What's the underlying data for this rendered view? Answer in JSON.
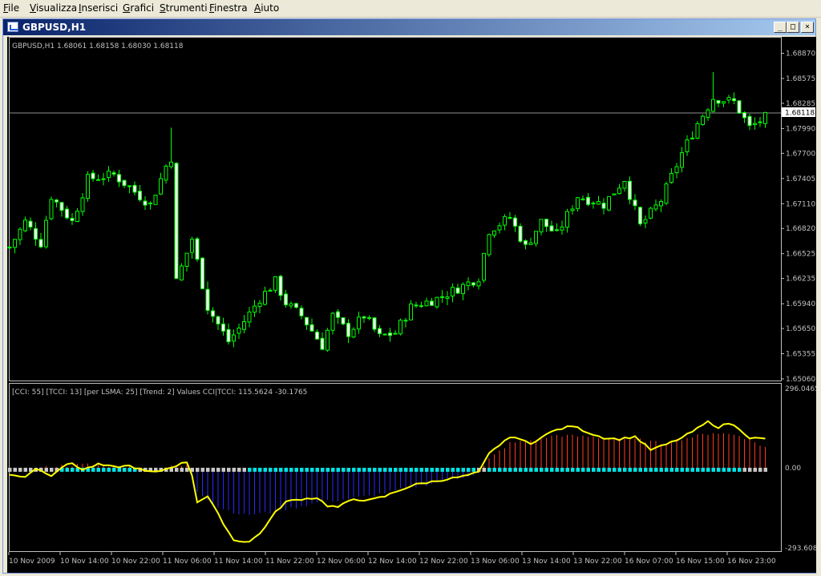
{
  "menu": [
    "File",
    "Visualizza",
    "Inserisci",
    "Grafici",
    "Strumenti",
    "Finestra",
    "Aiuto"
  ],
  "window": {
    "title": "GBPUSD,H1",
    "icon": "chart-window-icon",
    "buttons": {
      "minimize": "_",
      "maximize": "□",
      "close": "×"
    }
  },
  "colors": {
    "background": "#000000",
    "bull_candle": "#00ff00",
    "bear_candle_fill": "#ffffff",
    "cci_line": "#ffff00",
    "histogram_up": "#ff3b1f",
    "histogram_down": "#2a2aff",
    "trend_up_dot": "#00e5e5",
    "trend_neutral_dot": "#c8c8c8",
    "axis_text": "#c0c0c0"
  },
  "price_header": "GBPUSD,H1  1.68061 1.68158 1.68030 1.68118",
  "current_price": "1.68118",
  "price_axis": [
    "1.68870",
    "1.68575",
    "1.68285",
    "1.67990",
    "1.67700",
    "1.67405",
    "1.67110",
    "1.66820",
    "1.66525",
    "1.66235",
    "1.65940",
    "1.65650",
    "1.65355",
    "1.65060"
  ],
  "indicator_header": "[CCI: 55] [TCCI: 13] [per LSMA: 25] [Trend: 2] Values CCI|TCCI: 115.5624 -30.1765",
  "indicator_axis": {
    "top": "296.0465",
    "zero": "0.00",
    "bottom": "-293.608"
  },
  "time_axis": [
    "10 Nov 2009",
    "10 Nov 14:00",
    "10 Nov 22:00",
    "11 Nov 06:00",
    "11 Nov 14:00",
    "11 Nov 22:00",
    "12 Nov 06:00",
    "12 Nov 14:00",
    "12 Nov 22:00",
    "13 Nov 06:00",
    "13 Nov 14:00",
    "13 Nov 22:00",
    "16 Nov 07:00",
    "16 Nov 15:00",
    "16 Nov 23:00"
  ],
  "chart_data": [
    {
      "type": "candlestick",
      "title": "GBPUSD,H1",
      "ylim": [
        1.6506,
        1.6895
      ],
      "anchor_closes": [
        [
          0,
          1.666
        ],
        [
          3,
          1.669
        ],
        [
          6,
          1.6665
        ],
        [
          8,
          1.672
        ],
        [
          12,
          1.669
        ],
        [
          15,
          1.674
        ],
        [
          20,
          1.6745
        ],
        [
          27,
          1.671
        ],
        [
          30,
          1.6755
        ],
        [
          31,
          1.6765
        ],
        [
          32,
          1.662
        ],
        [
          35,
          1.667
        ],
        [
          38,
          1.659
        ],
        [
          42,
          1.655
        ],
        [
          44,
          1.6565
        ],
        [
          48,
          1.66
        ],
        [
          51,
          1.662
        ],
        [
          53,
          1.6595
        ],
        [
          56,
          1.658
        ],
        [
          60,
          1.6545
        ],
        [
          62,
          1.658
        ],
        [
          65,
          1.656
        ],
        [
          68,
          1.658
        ],
        [
          71,
          1.6555
        ],
        [
          74,
          1.656
        ],
        [
          77,
          1.659
        ],
        [
          82,
          1.66
        ],
        [
          87,
          1.6615
        ],
        [
          90,
          1.6625
        ],
        [
          92,
          1.668
        ],
        [
          96,
          1.6695
        ],
        [
          99,
          1.666
        ],
        [
          102,
          1.669
        ],
        [
          105,
          1.6675
        ],
        [
          109,
          1.672
        ],
        [
          114,
          1.671
        ],
        [
          118,
          1.674
        ],
        [
          121,
          1.6685
        ],
        [
          125,
          1.6715
        ],
        [
          129,
          1.677
        ],
        [
          132,
          1.6805
        ],
        [
          135,
          1.6835
        ],
        [
          139,
          1.683
        ],
        [
          142,
          1.68
        ],
        [
          145,
          1.6812
        ]
      ],
      "spike_highs": [
        [
          31,
          1.68
        ],
        [
          38,
          1.662
        ],
        [
          135,
          1.6865
        ]
      ]
    },
    {
      "type": "line",
      "title": "[CCI: 55] [TCCI: 13] [per LSMA: 25] [Trend: 2]",
      "ylim": [
        -293.608,
        296.0465
      ],
      "series": [
        {
          "name": "CCI",
          "points": [
            [
              0,
              -20
            ],
            [
              3,
              -25
            ],
            [
              5,
              5
            ],
            [
              8,
              -20
            ],
            [
              10,
              10
            ],
            [
              12,
              25
            ],
            [
              14,
              0
            ],
            [
              17,
              20
            ],
            [
              20,
              10
            ],
            [
              23,
              15
            ],
            [
              26,
              -5
            ],
            [
              28,
              -10
            ],
            [
              31,
              10
            ],
            [
              34,
              30
            ],
            [
              35,
              -20
            ],
            [
              36,
              -120
            ],
            [
              38,
              -100
            ],
            [
              41,
              -200
            ],
            [
              43,
              -265
            ],
            [
              46,
              -270
            ],
            [
              48,
              -240
            ],
            [
              51,
              -160
            ],
            [
              53,
              -120
            ],
            [
              56,
              -110
            ],
            [
              59,
              -105
            ],
            [
              61,
              -135
            ],
            [
              63,
              -140
            ],
            [
              66,
              -110
            ],
            [
              69,
              -115
            ],
            [
              72,
              -100
            ],
            [
              75,
              -75
            ],
            [
              78,
              -55
            ],
            [
              81,
              -45
            ],
            [
              84,
              -35
            ],
            [
              87,
              -25
            ],
            [
              90,
              -10
            ],
            [
              92,
              60
            ],
            [
              95,
              110
            ],
            [
              97,
              125
            ],
            [
              100,
              95
            ],
            [
              102,
              125
            ],
            [
              105,
              150
            ],
            [
              108,
              165
            ],
            [
              111,
              140
            ],
            [
              114,
              120
            ],
            [
              117,
              115
            ],
            [
              120,
              125
            ],
            [
              123,
              75
            ],
            [
              126,
              95
            ],
            [
              129,
              120
            ],
            [
              132,
              155
            ],
            [
              134,
              180
            ],
            [
              136,
              160
            ],
            [
              138,
              175
            ],
            [
              140,
              155
            ],
            [
              142,
              120
            ],
            [
              145,
              115.5624
            ]
          ]
        },
        {
          "name": "TCCI histogram",
          "points": [
            [
              0,
              0
            ],
            [
              5,
              5
            ],
            [
              10,
              15
            ],
            [
              15,
              20
            ],
            [
              20,
              15
            ],
            [
              25,
              5
            ],
            [
              30,
              10
            ],
            [
              34,
              15
            ],
            [
              36,
              -80
            ],
            [
              40,
              -140
            ],
            [
              45,
              -170
            ],
            [
              50,
              -160
            ],
            [
              55,
              -140
            ],
            [
              60,
              -120
            ],
            [
              65,
              -110
            ],
            [
              70,
              -95
            ],
            [
              75,
              -75
            ],
            [
              80,
              -55
            ],
            [
              85,
              -35
            ],
            [
              90,
              -15
            ],
            [
              92,
              40
            ],
            [
              96,
              100
            ],
            [
              100,
              110
            ],
            [
              105,
              130
            ],
            [
              110,
              125
            ],
            [
              115,
              120
            ],
            [
              120,
              115
            ],
            [
              125,
              100
            ],
            [
              130,
              120
            ],
            [
              135,
              140
            ],
            [
              140,
              130
            ],
            [
              145,
              85
            ]
          ]
        }
      ]
    }
  ]
}
